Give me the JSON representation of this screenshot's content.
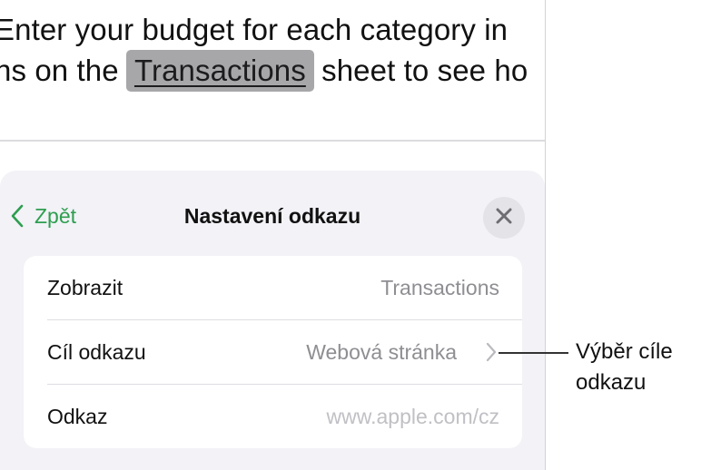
{
  "document": {
    "line1": "Enter your budget for each category in",
    "line2_before": "ns on the",
    "line2_link": "Transactions",
    "line2_after": "sheet to see ho"
  },
  "sheet": {
    "back_label": "Zpět",
    "title": "Nastavení odkazu",
    "close_icon": "close-icon",
    "rows": [
      {
        "label": "Zobrazit",
        "value": "Transactions"
      },
      {
        "label": "Cíl odkazu",
        "value": "Webová stránka"
      },
      {
        "label": "Odkaz",
        "value": "www.apple.com/cz"
      }
    ]
  },
  "callout": {
    "line1": "Výběr cíle",
    "line2": "odkazu"
  },
  "colors": {
    "accent_green": "#2e9e4f",
    "sheet_bg": "#f2f2f7",
    "link_highlight": "#a7a7a9"
  }
}
